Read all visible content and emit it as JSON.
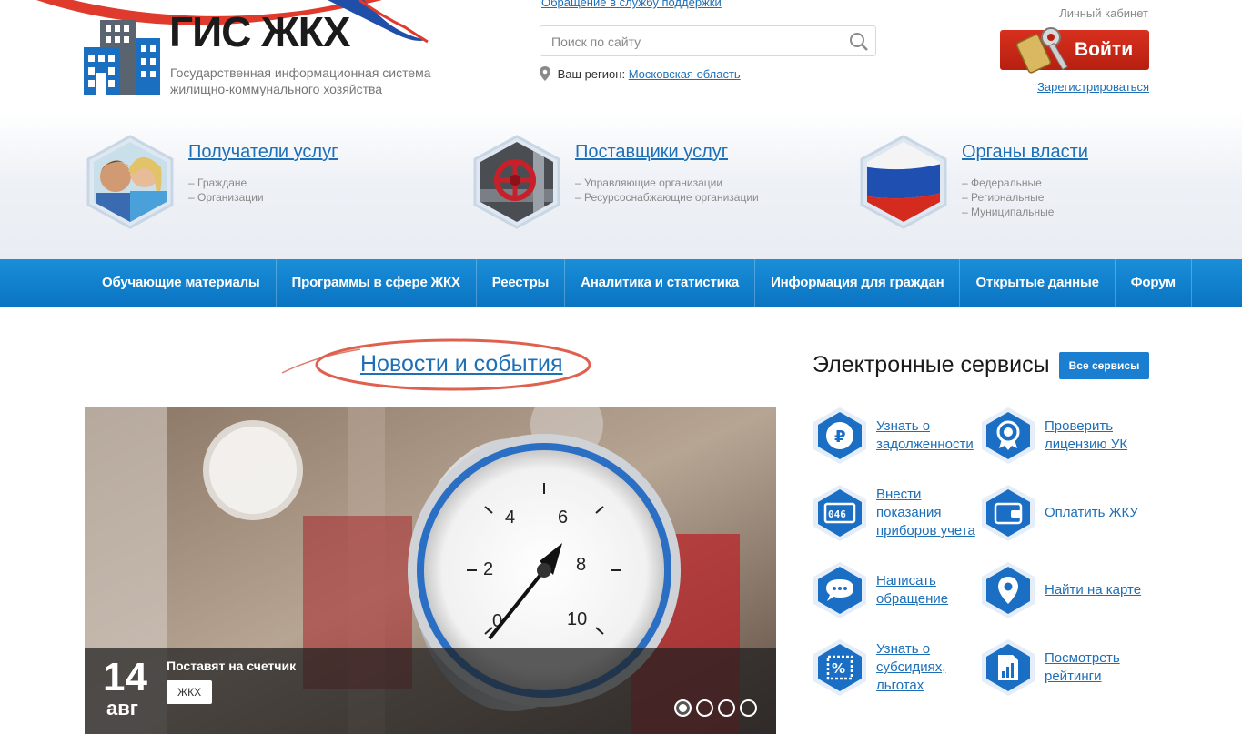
{
  "header": {
    "logo_title": "ГИС ЖКХ",
    "logo_subtitle": "Государственная информационная система жилищно-коммунального хозяйства",
    "support_link": "Обращение в службу поддержки",
    "search_placeholder": "Поиск по сайту",
    "region_label": "Ваш регион:",
    "region_value": "Московская область",
    "cabinet_label": "Личный кабинет",
    "login_label": "Войти",
    "register_label": "Зарегистрироваться"
  },
  "groups": [
    {
      "title": "Получатели услуг",
      "items": [
        "– Граждане",
        "– Организации"
      ]
    },
    {
      "title": "Поставщики услуг",
      "items": [
        "– Управляющие организации",
        "– Ресурсоснабжающие организации"
      ]
    },
    {
      "title": "Органы власти",
      "items": [
        "– Федеральные",
        "– Региональные",
        "– Муниципальные"
      ]
    }
  ],
  "nav": [
    "Обучающие материалы",
    "Программы в сфере ЖКХ",
    "Реестры",
    "Аналитика и статистика",
    "Информация для граждан",
    "Открытые данные",
    "Форум"
  ],
  "news": {
    "heading": "Новости и события",
    "slide": {
      "day": "14",
      "month": "авг",
      "title": "Поставят на счетчик",
      "tag": "ЖКХ"
    },
    "slide_count": 4,
    "active_slide": 1
  },
  "services": {
    "title": "Электронные сервисы",
    "all_label": "Все сервисы",
    "items": [
      {
        "label": "Узнать о задолженности",
        "icon": "ruble-icon"
      },
      {
        "label": "Проверить лицензию УК",
        "icon": "license-badge-icon"
      },
      {
        "label": "Внести показания приборов учета",
        "icon": "meter-icon"
      },
      {
        "label": "Оплатить ЖКУ",
        "icon": "wallet-icon"
      },
      {
        "label": "Написать обращение",
        "icon": "chat-icon"
      },
      {
        "label": "Найти на карте",
        "icon": "map-pin-icon"
      },
      {
        "label": "Узнать о субсидиях, льготах",
        "icon": "percent-icon"
      },
      {
        "label": "Посмотреть рейтинги",
        "icon": "rating-chart-icon"
      }
    ]
  },
  "colors": {
    "brand_blue": "#1d6fb8",
    "nav_blue": "#0a74c2",
    "login_red": "#c9281a"
  }
}
